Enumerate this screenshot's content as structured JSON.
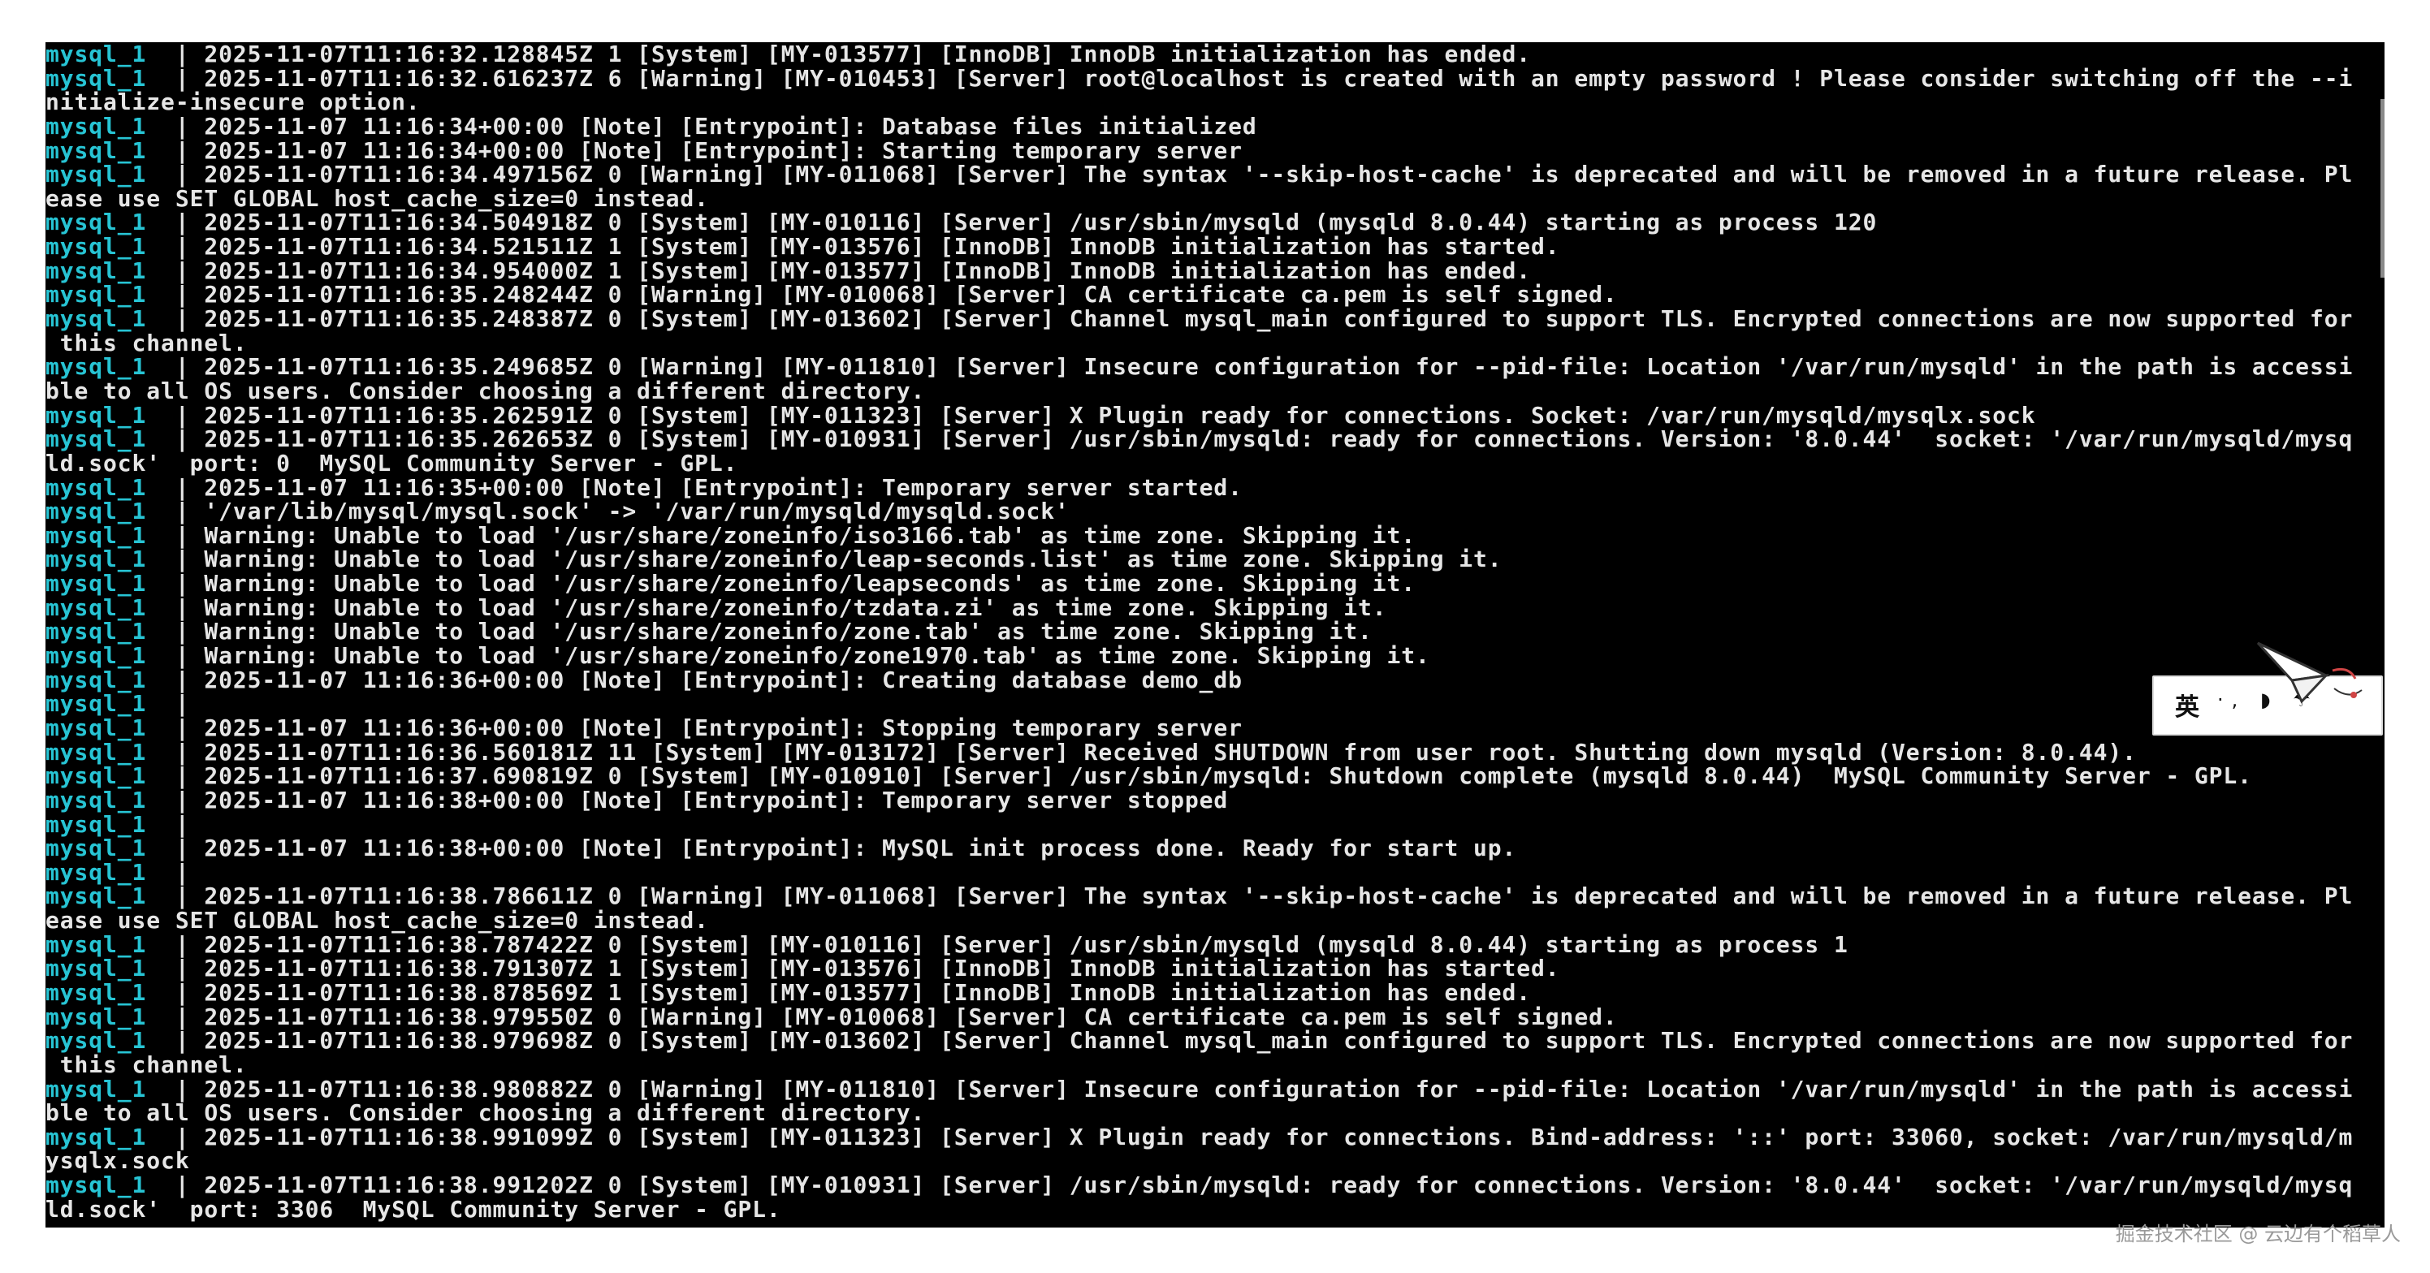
{
  "terminal": {
    "lines": [
      {
        "prefix": "mysql_1",
        "sep": "|",
        "text": "2025-11-07T11:16:32.128845Z 1 [System] [MY-013577] [InnoDB] InnoDB initialization has ended."
      },
      {
        "prefix": "mysql_1",
        "sep": "|",
        "text": "2025-11-07T11:16:32.616237Z 6 [Warning] [MY-010453] [Server] root@localhost is created with an empty password ! Please consider switching off the --i"
      },
      {
        "prefix": "",
        "sep": "",
        "text": "nitialize-insecure option."
      },
      {
        "prefix": "mysql_1",
        "sep": "|",
        "text": "2025-11-07 11:16:34+00:00 [Note] [Entrypoint]: Database files initialized"
      },
      {
        "prefix": "mysql_1",
        "sep": "|",
        "text": "2025-11-07 11:16:34+00:00 [Note] [Entrypoint]: Starting temporary server"
      },
      {
        "prefix": "mysql_1",
        "sep": "|",
        "text": "2025-11-07T11:16:34.497156Z 0 [Warning] [MY-011068] [Server] The syntax '--skip-host-cache' is deprecated and will be removed in a future release. Pl"
      },
      {
        "prefix": "",
        "sep": "",
        "text": "ease use SET GLOBAL host_cache_size=0 instead."
      },
      {
        "prefix": "mysql_1",
        "sep": "|",
        "text": "2025-11-07T11:16:34.504918Z 0 [System] [MY-010116] [Server] /usr/sbin/mysqld (mysqld 8.0.44) starting as process 120"
      },
      {
        "prefix": "mysql_1",
        "sep": "|",
        "text": "2025-11-07T11:16:34.521511Z 1 [System] [MY-013576] [InnoDB] InnoDB initialization has started."
      },
      {
        "prefix": "mysql_1",
        "sep": "|",
        "text": "2025-11-07T11:16:34.954000Z 1 [System] [MY-013577] [InnoDB] InnoDB initialization has ended."
      },
      {
        "prefix": "mysql_1",
        "sep": "|",
        "text": "2025-11-07T11:16:35.248244Z 0 [Warning] [MY-010068] [Server] CA certificate ca.pem is self signed."
      },
      {
        "prefix": "mysql_1",
        "sep": "|",
        "text": "2025-11-07T11:16:35.248387Z 0 [System] [MY-013602] [Server] Channel mysql_main configured to support TLS. Encrypted connections are now supported for"
      },
      {
        "prefix": "",
        "sep": "",
        "text": " this channel."
      },
      {
        "prefix": "mysql_1",
        "sep": "|",
        "text": "2025-11-07T11:16:35.249685Z 0 [Warning] [MY-011810] [Server] Insecure configuration for --pid-file: Location '/var/run/mysqld' in the path is accessi"
      },
      {
        "prefix": "",
        "sep": "",
        "text": "ble to all OS users. Consider choosing a different directory."
      },
      {
        "prefix": "mysql_1",
        "sep": "|",
        "text": "2025-11-07T11:16:35.262591Z 0 [System] [MY-011323] [Server] X Plugin ready for connections. Socket: /var/run/mysqld/mysqlx.sock"
      },
      {
        "prefix": "mysql_1",
        "sep": "|",
        "text": "2025-11-07T11:16:35.262653Z 0 [System] [MY-010931] [Server] /usr/sbin/mysqld: ready for connections. Version: '8.0.44'  socket: '/var/run/mysqld/mysq"
      },
      {
        "prefix": "",
        "sep": "",
        "text": "ld.sock'  port: 0  MySQL Community Server - GPL."
      },
      {
        "prefix": "mysql_1",
        "sep": "|",
        "text": "2025-11-07 11:16:35+00:00 [Note] [Entrypoint]: Temporary server started."
      },
      {
        "prefix": "mysql_1",
        "sep": "|",
        "text": "'/var/lib/mysql/mysql.sock' -> '/var/run/mysqld/mysqld.sock'"
      },
      {
        "prefix": "mysql_1",
        "sep": "|",
        "text": "Warning: Unable to load '/usr/share/zoneinfo/iso3166.tab' as time zone. Skipping it."
      },
      {
        "prefix": "mysql_1",
        "sep": "|",
        "text": "Warning: Unable to load '/usr/share/zoneinfo/leap-seconds.list' as time zone. Skipping it."
      },
      {
        "prefix": "mysql_1",
        "sep": "|",
        "text": "Warning: Unable to load '/usr/share/zoneinfo/leapseconds' as time zone. Skipping it."
      },
      {
        "prefix": "mysql_1",
        "sep": "|",
        "text": "Warning: Unable to load '/usr/share/zoneinfo/tzdata.zi' as time zone. Skipping it."
      },
      {
        "prefix": "mysql_1",
        "sep": "|",
        "text": "Warning: Unable to load '/usr/share/zoneinfo/zone.tab' as time zone. Skipping it."
      },
      {
        "prefix": "mysql_1",
        "sep": "|",
        "text": "Warning: Unable to load '/usr/share/zoneinfo/zone1970.tab' as time zone. Skipping it."
      },
      {
        "prefix": "mysql_1",
        "sep": "|",
        "text": "2025-11-07 11:16:36+00:00 [Note] [Entrypoint]: Creating database demo_db"
      },
      {
        "prefix": "mysql_1",
        "sep": "|",
        "text": ""
      },
      {
        "prefix": "mysql_1",
        "sep": "|",
        "text": "2025-11-07 11:16:36+00:00 [Note] [Entrypoint]: Stopping temporary server"
      },
      {
        "prefix": "mysql_1",
        "sep": "|",
        "text": "2025-11-07T11:16:36.560181Z 11 [System] [MY-013172] [Server] Received SHUTDOWN from user root. Shutting down mysqld (Version: 8.0.44)."
      },
      {
        "prefix": "mysql_1",
        "sep": "|",
        "text": "2025-11-07T11:16:37.690819Z 0 [System] [MY-010910] [Server] /usr/sbin/mysqld: Shutdown complete (mysqld 8.0.44)  MySQL Community Server - GPL."
      },
      {
        "prefix": "mysql_1",
        "sep": "|",
        "text": "2025-11-07 11:16:38+00:00 [Note] [Entrypoint]: Temporary server stopped"
      },
      {
        "prefix": "mysql_1",
        "sep": "|",
        "text": ""
      },
      {
        "prefix": "mysql_1",
        "sep": "|",
        "text": "2025-11-07 11:16:38+00:00 [Note] [Entrypoint]: MySQL init process done. Ready for start up."
      },
      {
        "prefix": "mysql_1",
        "sep": "|",
        "text": ""
      },
      {
        "prefix": "mysql_1",
        "sep": "|",
        "text": "2025-11-07T11:16:38.786611Z 0 [Warning] [MY-011068] [Server] The syntax '--skip-host-cache' is deprecated and will be removed in a future release. Pl"
      },
      {
        "prefix": "",
        "sep": "",
        "text": "ease use SET GLOBAL host_cache_size=0 instead."
      },
      {
        "prefix": "mysql_1",
        "sep": "|",
        "text": "2025-11-07T11:16:38.787422Z 0 [System] [MY-010116] [Server] /usr/sbin/mysqld (mysqld 8.0.44) starting as process 1"
      },
      {
        "prefix": "mysql_1",
        "sep": "|",
        "text": "2025-11-07T11:16:38.791307Z 1 [System] [MY-013576] [InnoDB] InnoDB initialization has started."
      },
      {
        "prefix": "mysql_1",
        "sep": "|",
        "text": "2025-11-07T11:16:38.878569Z 1 [System] [MY-013577] [InnoDB] InnoDB initialization has ended."
      },
      {
        "prefix": "mysql_1",
        "sep": "|",
        "text": "2025-11-07T11:16:38.979550Z 0 [Warning] [MY-010068] [Server] CA certificate ca.pem is self signed."
      },
      {
        "prefix": "mysql_1",
        "sep": "|",
        "text": "2025-11-07T11:16:38.979698Z 0 [System] [MY-013602] [Server] Channel mysql_main configured to support TLS. Encrypted connections are now supported for"
      },
      {
        "prefix": "",
        "sep": "",
        "text": " this channel."
      },
      {
        "prefix": "mysql_1",
        "sep": "|",
        "text": "2025-11-07T11:16:38.980882Z 0 [Warning] [MY-011810] [Server] Insecure configuration for --pid-file: Location '/var/run/mysqld' in the path is accessi"
      },
      {
        "prefix": "",
        "sep": "",
        "text": "ble to all OS users. Consider choosing a different directory."
      },
      {
        "prefix": "mysql_1",
        "sep": "|",
        "text": "2025-11-07T11:16:38.991099Z 0 [System] [MY-011323] [Server] X Plugin ready for connections. Bind-address: '::' port: 33060, socket: /var/run/mysqld/m"
      },
      {
        "prefix": "",
        "sep": "",
        "text": "ysqlx.sock"
      },
      {
        "prefix": "mysql_1",
        "sep": "|",
        "text": "2025-11-07T11:16:38.991202Z 0 [System] [MY-010931] [Server] /usr/sbin/mysqld: ready for connections. Version: '8.0.44'  socket: '/var/run/mysqld/mysq"
      },
      {
        "prefix": "",
        "sep": "",
        "text": "ld.sock'  port: 3306  MySQL Community Server - GPL."
      }
    ]
  },
  "ime": {
    "label": "英",
    "icons": "·, ◗ ☂"
  },
  "watermark": "掘金技术社区 @ 云边有个稻草人",
  "colors": {
    "background": "#000000",
    "text": "#e6e6e6",
    "prefix": "#27c4d4"
  }
}
